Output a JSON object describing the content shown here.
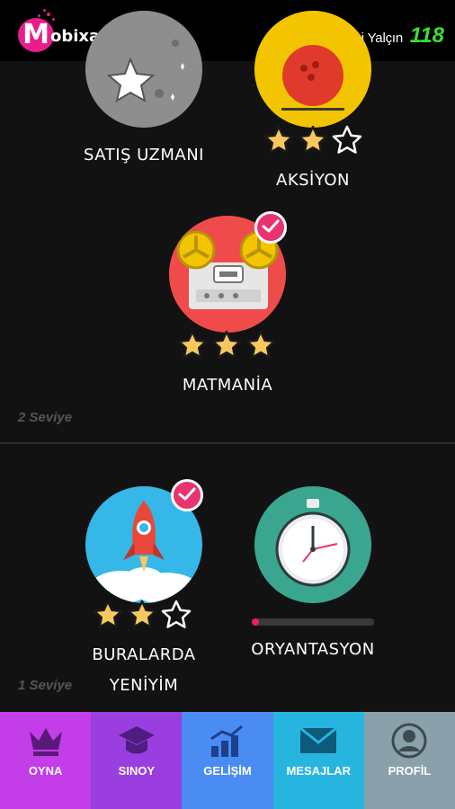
{
  "header": {
    "logo_letter": "M",
    "logo_text": "obixa",
    "user_name": "Hüseyin Avni Yalçın",
    "score": "118"
  },
  "levels": [
    {
      "label": "2 Seviye",
      "badges": [
        {
          "name": "SATIŞ UZMANI",
          "stars": null,
          "completed": false
        },
        {
          "name": "AKSİYON",
          "stars": 2,
          "completed": false
        },
        {
          "name": "MATMANİA",
          "stars": 3,
          "completed": true
        }
      ]
    },
    {
      "label": "1 Seviye",
      "badges": [
        {
          "name_line1": "BURALARDA",
          "name_line2": "YENİYİM",
          "stars": 2,
          "completed": true
        },
        {
          "name": "ORYANTASYON",
          "progress": 0.05,
          "completed": false
        }
      ]
    }
  ],
  "tabs": [
    {
      "label": "OYNA",
      "color": "#c33de8",
      "icon": "crown-icon"
    },
    {
      "label": "SINOY",
      "color": "#9a3ee0",
      "icon": "graduation-cap-icon"
    },
    {
      "label": "GELİŞİM",
      "color": "#4a8cf2",
      "icon": "growth-chart-icon"
    },
    {
      "label": "MESAJLAR",
      "color": "#27b5e0",
      "icon": "envelope-icon"
    },
    {
      "label": "PROFİL",
      "color": "#8aa1ab",
      "icon": "profile-icon"
    }
  ],
  "colors": {
    "brand": "#e91e8c",
    "score": "#3ddc35",
    "star_filled": "#f6c85f",
    "check": "#e8336e"
  }
}
